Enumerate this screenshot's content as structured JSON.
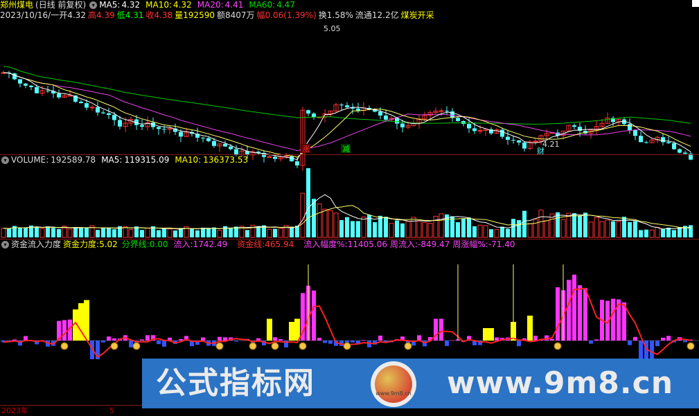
{
  "header": {
    "title": "郑州煤电",
    "period": "(日线 前复权)",
    "ma5_label": "MA5:",
    "ma5": "4.32",
    "ma10_label": "MA10:",
    "ma10": "4.32",
    "ma20_label": "MA20:",
    "ma20": "4.41",
    "ma60_label": "MA60:",
    "ma60": "4.47",
    "ma5_color": "#ffffff",
    "ma10_color": "#ffff00",
    "ma20_color": "#ff44ff",
    "ma60_color": "#00dd00"
  },
  "quote": {
    "date": "2023/10/16/一",
    "open_label": "开",
    "open": "4.32",
    "high_label": "高",
    "high": "4.39",
    "low_label": "低",
    "low": "4.31",
    "close_label": "收",
    "close": "4.38",
    "vol_label": "量",
    "vol": "192590",
    "amount_label": "额",
    "amount": "8407万",
    "chg_label": "幅",
    "chg": "0.06(1.39%)",
    "turnover_label": "换",
    "turnover": "1.58%",
    "float_label": "流通",
    "float": "12.2亿",
    "concept": "煤炭开采"
  },
  "price_annotations": {
    "high_mark": "5.05",
    "low_mark": "4.21",
    "tag_up": "涨",
    "tag_down": "减",
    "tag_fin": "财"
  },
  "volume": {
    "label": "VOLUME:",
    "value": "192589.78",
    "ma5_label": "MA5:",
    "ma5": "119315.09",
    "ma10_label": "MA10:",
    "ma10": "136373.53"
  },
  "indicator": {
    "name": "资金流入力度",
    "force_label": "资金力度:",
    "force": "5.02",
    "divider_label": "分界线:",
    "divider": "0.00",
    "inflow_label": "流入:",
    "inflow": "1742.49",
    "fundline_label": "资金线:",
    "fundline": "465.94",
    "inflow_pct_label": "流入幅度%:",
    "inflow_pct": "11405.06",
    "week_inflow_label": "周流入:",
    "week_inflow": "-849.47",
    "week_chg_label": "周涨幅%:",
    "week_chg": "-71.40"
  },
  "statusbar": {
    "year": "2023年",
    "month": "5"
  },
  "watermark": {
    "left_text": "公式指标网",
    "right_text": "www.9m8.cn",
    "logo_text": "www.9m8.cn"
  },
  "colors": {
    "up": "#ff3232",
    "down": "#54ffff",
    "inflow_bar": "#ff33ff",
    "yellow_bar": "#ffff00",
    "outflow_bar": "#3355ff",
    "separator": "#8b1a1a"
  }
}
